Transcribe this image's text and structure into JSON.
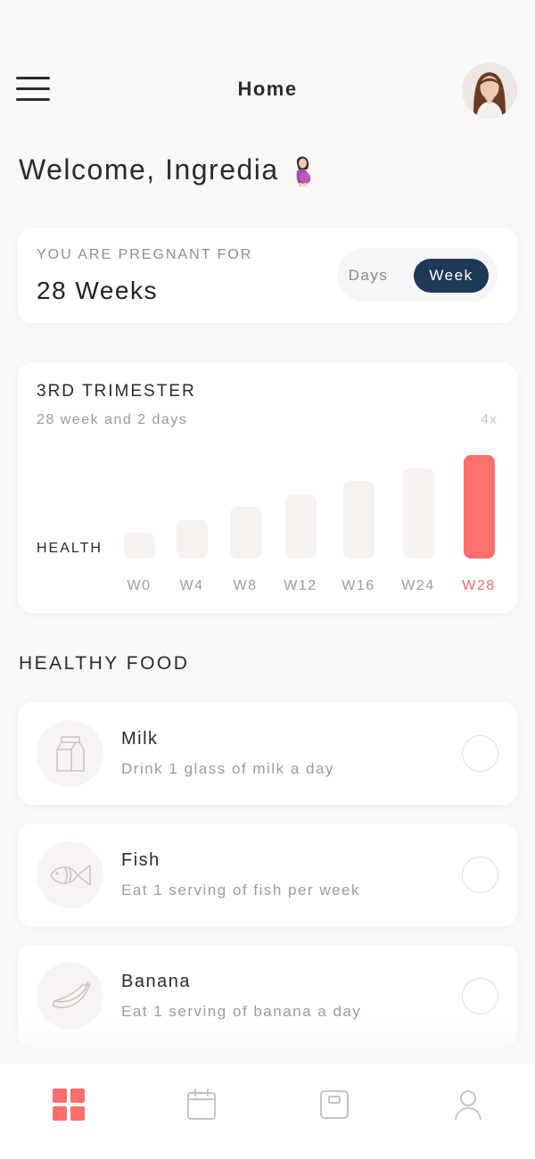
{
  "header": {
    "title": "Home"
  },
  "welcome": {
    "text": "Welcome, Ingredia",
    "icon": "pregnant-woman-icon"
  },
  "pregnancy": {
    "label": "YOU ARE PREGNANT FOR",
    "value": "28 Weeks",
    "toggle": {
      "options": [
        "Days",
        "Week"
      ],
      "selected": "Week"
    }
  },
  "trimester": {
    "title": "3RD TRIMESTER",
    "subtitle": "28 week and 2 days",
    "multiplier": "4x",
    "health_label": "HEALTH"
  },
  "chart_data": {
    "type": "bar",
    "categories": [
      "W0",
      "W4",
      "W8",
      "W12",
      "W16",
      "W24",
      "W28"
    ],
    "values": [
      2,
      3,
      4,
      5,
      6,
      7,
      8
    ],
    "highlighted": "W28",
    "title": "",
    "xlabel": "",
    "ylabel": "HEALTH"
  },
  "healthy_food": {
    "title": "HEALTHY FOOD",
    "items": [
      {
        "name": "Milk",
        "desc": "Drink 1 glass of milk a day",
        "icon": "milk-carton-icon",
        "checked": false
      },
      {
        "name": "Fish",
        "desc": "Eat 1 serving of fish per week",
        "icon": "fish-icon",
        "checked": false
      },
      {
        "name": "Banana",
        "desc": "Eat 1 serving of banana a day",
        "icon": "banana-icon",
        "checked": false
      }
    ]
  },
  "bottom_nav": {
    "items": [
      {
        "icon": "dashboard-icon",
        "active": true
      },
      {
        "icon": "calendar-icon",
        "active": false
      },
      {
        "icon": "notebook-icon",
        "active": false
      },
      {
        "icon": "profile-icon",
        "active": false
      }
    ]
  },
  "colors": {
    "accent": "#ff6f6b",
    "navy": "#1d3957",
    "bar_inactive": "#f7f1f0",
    "background": "#f8f8f8"
  }
}
